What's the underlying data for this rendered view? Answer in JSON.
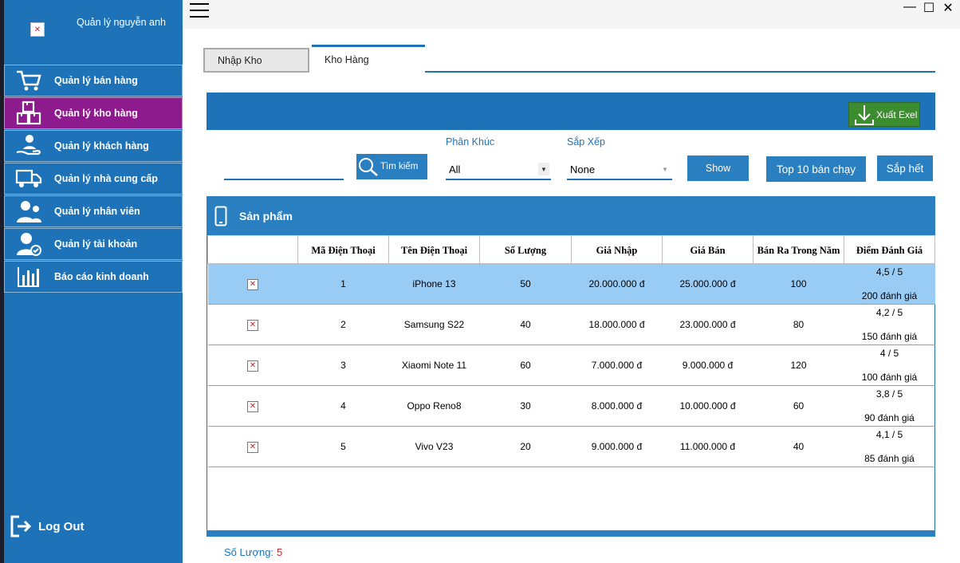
{
  "sidebar": {
    "user_name": "Quản lý nguyễn anh",
    "items": [
      {
        "label": "Quản lý bán hàng",
        "icon": "cart-icon"
      },
      {
        "label": "Quản lý kho hàng",
        "icon": "boxes-icon",
        "active": true
      },
      {
        "label": "Quản lý khách hàng",
        "icon": "customer-hand-icon"
      },
      {
        "label": "Quản lý nhà cung cấp",
        "icon": "truck-icon"
      },
      {
        "label": "Quản lý nhân viên",
        "icon": "staff-icon"
      },
      {
        "label": "Quản lý tài khoản",
        "icon": "account-check-icon"
      },
      {
        "label": "Báo cáo kinh doanh",
        "icon": "bar-chart-icon"
      }
    ],
    "logout_label": "Log Out"
  },
  "tabs": {
    "nhap_kho": "Nhập Kho",
    "kho_hang": "Kho Hàng"
  },
  "toolbar": {
    "export_label": "Xuất Exel",
    "search_label": "Tìm kiếm",
    "search_value": "",
    "phan_khuc_label": "Phân Khúc",
    "phan_khuc_value": "All",
    "sap_xep_label": "Sắp Xếp",
    "sap_xep_value": "None",
    "show_label": "Show",
    "top10_label": "Top 10 bán chạy",
    "sap_het_label": "Sắp hết"
  },
  "panel": {
    "title": "Sản phẩm"
  },
  "table": {
    "headers": [
      "",
      "Mã Điện Thoại",
      "Tên Điện Thoại",
      "Số Lượng",
      "Giá Nhập",
      "Giá Bán",
      "Bán Ra Trong Năm",
      "Điểm Đánh Giá"
    ],
    "rows": [
      {
        "id": "1",
        "name": "iPhone 13",
        "qty": "50",
        "import_price": "20.000.000 đ",
        "sale_price": "25.000.000 đ",
        "sold": "100",
        "score": "4,5 / 5",
        "reviews": "200 đánh giá"
      },
      {
        "id": "2",
        "name": "Samsung S22",
        "qty": "40",
        "import_price": "18.000.000 đ",
        "sale_price": "23.000.000 đ",
        "sold": "80",
        "score": "4,2 / 5",
        "reviews": "150 đánh giá"
      },
      {
        "id": "3",
        "name": "Xiaomi Note 11",
        "qty": "60",
        "import_price": "7.000.000 đ",
        "sale_price": "9.000.000 đ",
        "sold": "120",
        "score": "4 / 5",
        "reviews": "100 đánh giá"
      },
      {
        "id": "4",
        "name": "Oppo Reno8",
        "qty": "30",
        "import_price": "8.000.000 đ",
        "sale_price": "10.000.000 đ",
        "sold": "60",
        "score": "3,8 / 5",
        "reviews": "90 đánh giá"
      },
      {
        "id": "5",
        "name": "Vivo V23",
        "qty": "20",
        "import_price": "9.000.000 đ",
        "sale_price": "11.000.000 đ",
        "sold": "40",
        "score": "4,1 / 5",
        "reviews": "85 đánh giá"
      }
    ]
  },
  "footer": {
    "count_label": "Số Lượng:",
    "count_value": "5"
  }
}
